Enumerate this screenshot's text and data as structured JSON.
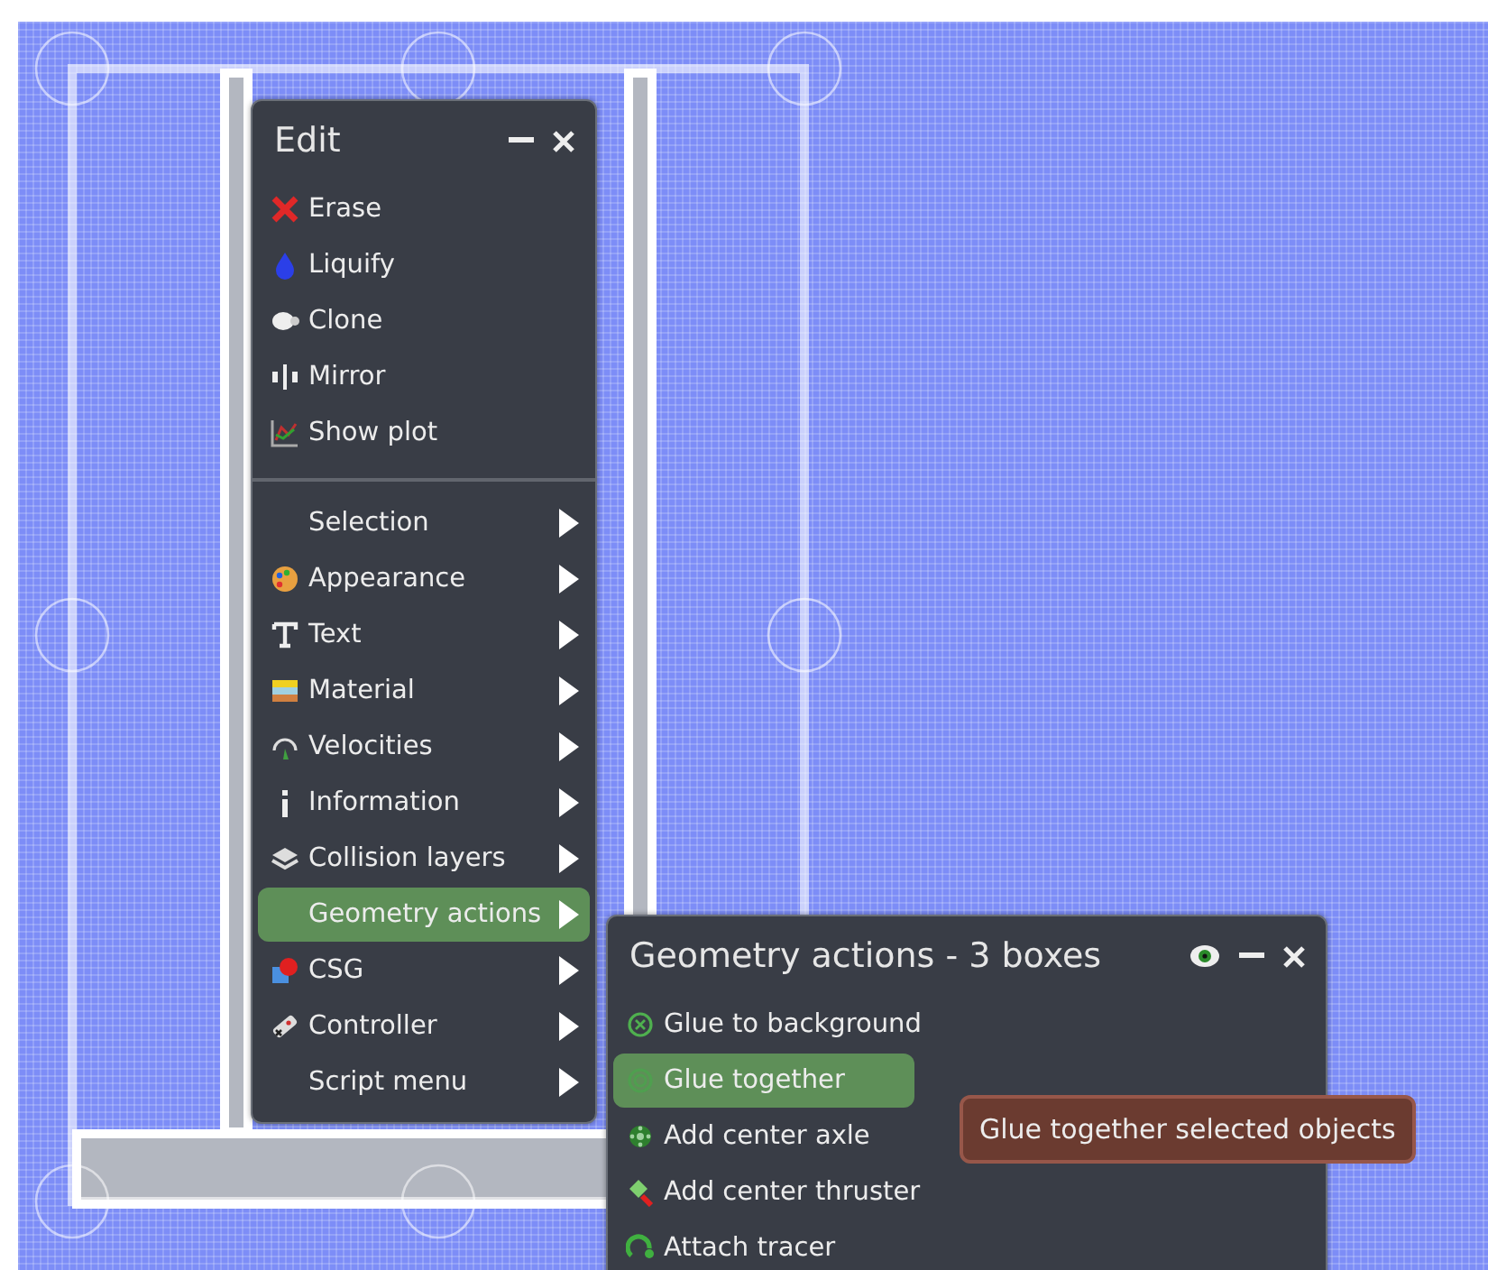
{
  "edit_window": {
    "title": "Edit",
    "actions": [
      {
        "label": "Erase"
      },
      {
        "label": "Liquify"
      },
      {
        "label": "Clone"
      },
      {
        "label": "Mirror"
      },
      {
        "label": "Show plot"
      }
    ],
    "submenus": [
      {
        "label": "Selection",
        "selected": false
      },
      {
        "label": "Appearance",
        "selected": false
      },
      {
        "label": "Text",
        "selected": false
      },
      {
        "label": "Material",
        "selected": false
      },
      {
        "label": "Velocities",
        "selected": false
      },
      {
        "label": "Information",
        "selected": false
      },
      {
        "label": "Collision layers",
        "selected": false
      },
      {
        "label": "Geometry actions",
        "selected": true
      },
      {
        "label": "CSG",
        "selected": false
      },
      {
        "label": "Controller",
        "selected": false
      },
      {
        "label": "Script menu",
        "selected": false
      }
    ]
  },
  "geometry_window": {
    "title": "Geometry actions - 3 boxes",
    "items": [
      {
        "label": "Glue to background",
        "selected": false
      },
      {
        "label": "Glue together",
        "selected": true
      },
      {
        "label": "Add center axle",
        "selected": false
      },
      {
        "label": "Add center thruster",
        "selected": false
      },
      {
        "label": "Attach tracer",
        "selected": false
      }
    ]
  },
  "tooltip": {
    "text": "Glue together selected objects"
  }
}
